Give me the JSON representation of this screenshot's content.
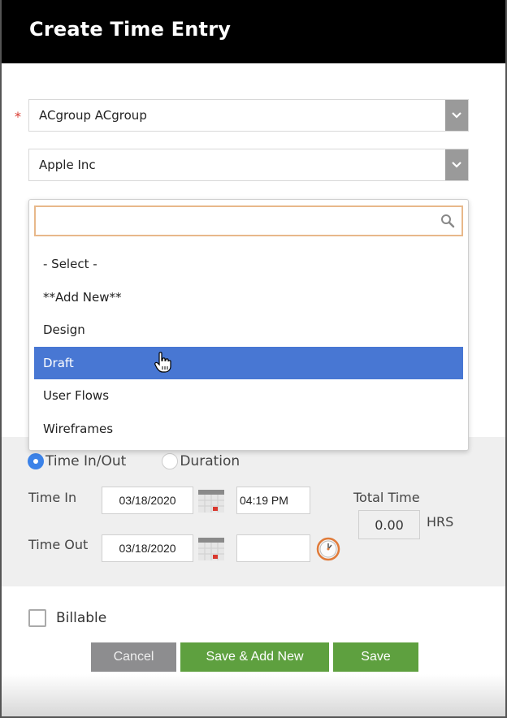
{
  "header": {
    "title": "Create Time Entry"
  },
  "form": {
    "employee": {
      "value": "ACgroup ACgroup",
      "required": true,
      "required_marker": "*"
    },
    "customer": {
      "value": "Apple Inc"
    },
    "task_dropdown": {
      "search_placeholder": "",
      "search_value": "",
      "options": [
        "- Select -",
        "**Add New**",
        "Design",
        "Draft",
        "User Flows",
        "Wireframes"
      ],
      "highlighted": "Draft"
    },
    "mode": {
      "options": [
        "Time In/Out",
        "Duration"
      ],
      "selected": "Time In/Out"
    },
    "time_in": {
      "label": "Time In",
      "date": "03/18/2020",
      "time": "04:19 PM"
    },
    "time_out": {
      "label": "Time Out",
      "date": "03/18/2020",
      "time": ""
    },
    "total_time": {
      "label": "Total Time",
      "value": "0.00",
      "unit": "HRS"
    },
    "billable": {
      "label": "Billable",
      "checked": false
    }
  },
  "buttons": {
    "cancel": "Cancel",
    "save_add_new": "Save & Add New",
    "save": "Save"
  },
  "colors": {
    "header_bg": "#000000",
    "highlight": "#4877d3",
    "primary_button": "#5ea03f",
    "cancel_button": "#8d8d8f",
    "required": "#d9382e",
    "search_border": "#e8b88a"
  }
}
